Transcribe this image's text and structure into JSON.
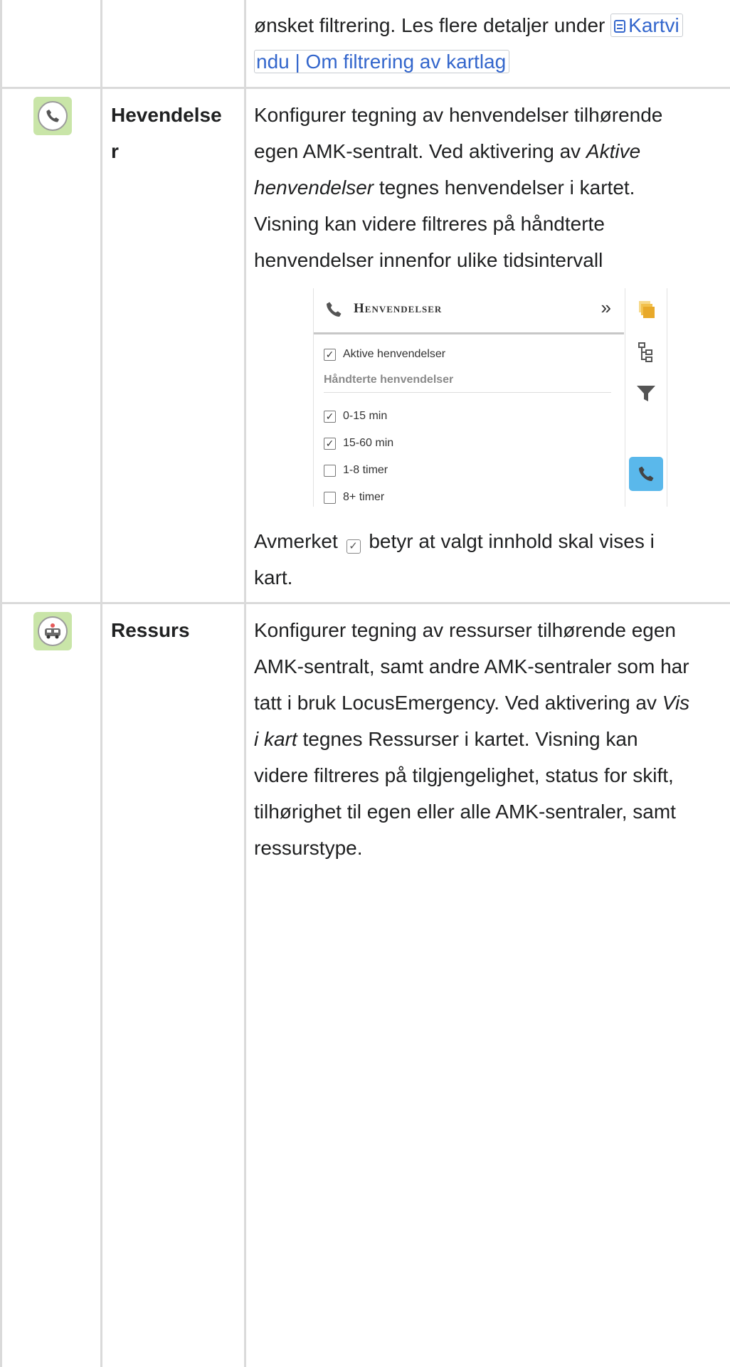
{
  "top_row": {
    "line1": "ønsket filtrering. Les flere detaljer under",
    "link_part1": "Kartvi",
    "link_part2": "ndu | Om filtrering av kartlag"
  },
  "hevendelser_row": {
    "icon": "phone-icon",
    "name_line1": "Hevendelse",
    "name_line2": "r",
    "desc": [
      {
        "text": "Konfigurer tegning av henvendelser tilhørende"
      },
      {
        "text_a": "egen AMK-sentralt. Ved aktivering av ",
        "em": "Aktive"
      },
      {
        "em": "henvendelser",
        "text_b": " tegnes henvendelser i kartet."
      },
      {
        "text": "Visning kan videre filtreres på håndterte"
      },
      {
        "text": "henvendelser innenfor ulike tidsintervall"
      }
    ],
    "screenshot": {
      "title": "Henvendelser",
      "collapse_symbol": "»",
      "active_label": "Aktive henvendelser",
      "active_checked": true,
      "section_label": "Håndterte henvendelser",
      "options": [
        {
          "label": "0-15 min",
          "checked": true
        },
        {
          "label": "15-60 min",
          "checked": true
        },
        {
          "label": "1-8 timer",
          "checked": false
        },
        {
          "label": "8+ timer",
          "checked": false
        }
      ],
      "rail_icons": [
        "layers-icon",
        "tree-icon",
        "filter-icon",
        "phone-icon"
      ],
      "colors": {
        "rail_active": "#5ab8eb",
        "layers": "#f2c14e",
        "filter": "#555555"
      }
    },
    "note_before": "Avmerket",
    "note_after": "betyr at valgt innhold skal vises i",
    "note_line2": "kart."
  },
  "ressurs_row": {
    "icon": "ambulance-icon",
    "name": "Ressurs",
    "desc": [
      {
        "text": "Konfigurer tegning av ressurser tilhørende egen"
      },
      {
        "text": "AMK-sentralt, samt andre AMK-sentraler som har"
      },
      {
        "text_a": "tatt i bruk LocusEmergency. Ved aktivering av ",
        "em": "Vis"
      },
      {
        "em": "i kart",
        "text_b": " tegnes Ressurser i kartet. Visning kan"
      },
      {
        "text": "videre filtreres på tilgjengelighet, status for skift,"
      },
      {
        "text": "tilhørighet til egen eller alle AMK-sentraler, samt"
      },
      {
        "text": "ressurstype."
      }
    ]
  },
  "colors": {
    "link": "#3366cc",
    "border": "#dadada",
    "text": "#202122",
    "icon_bg": "#c9e5a8"
  }
}
